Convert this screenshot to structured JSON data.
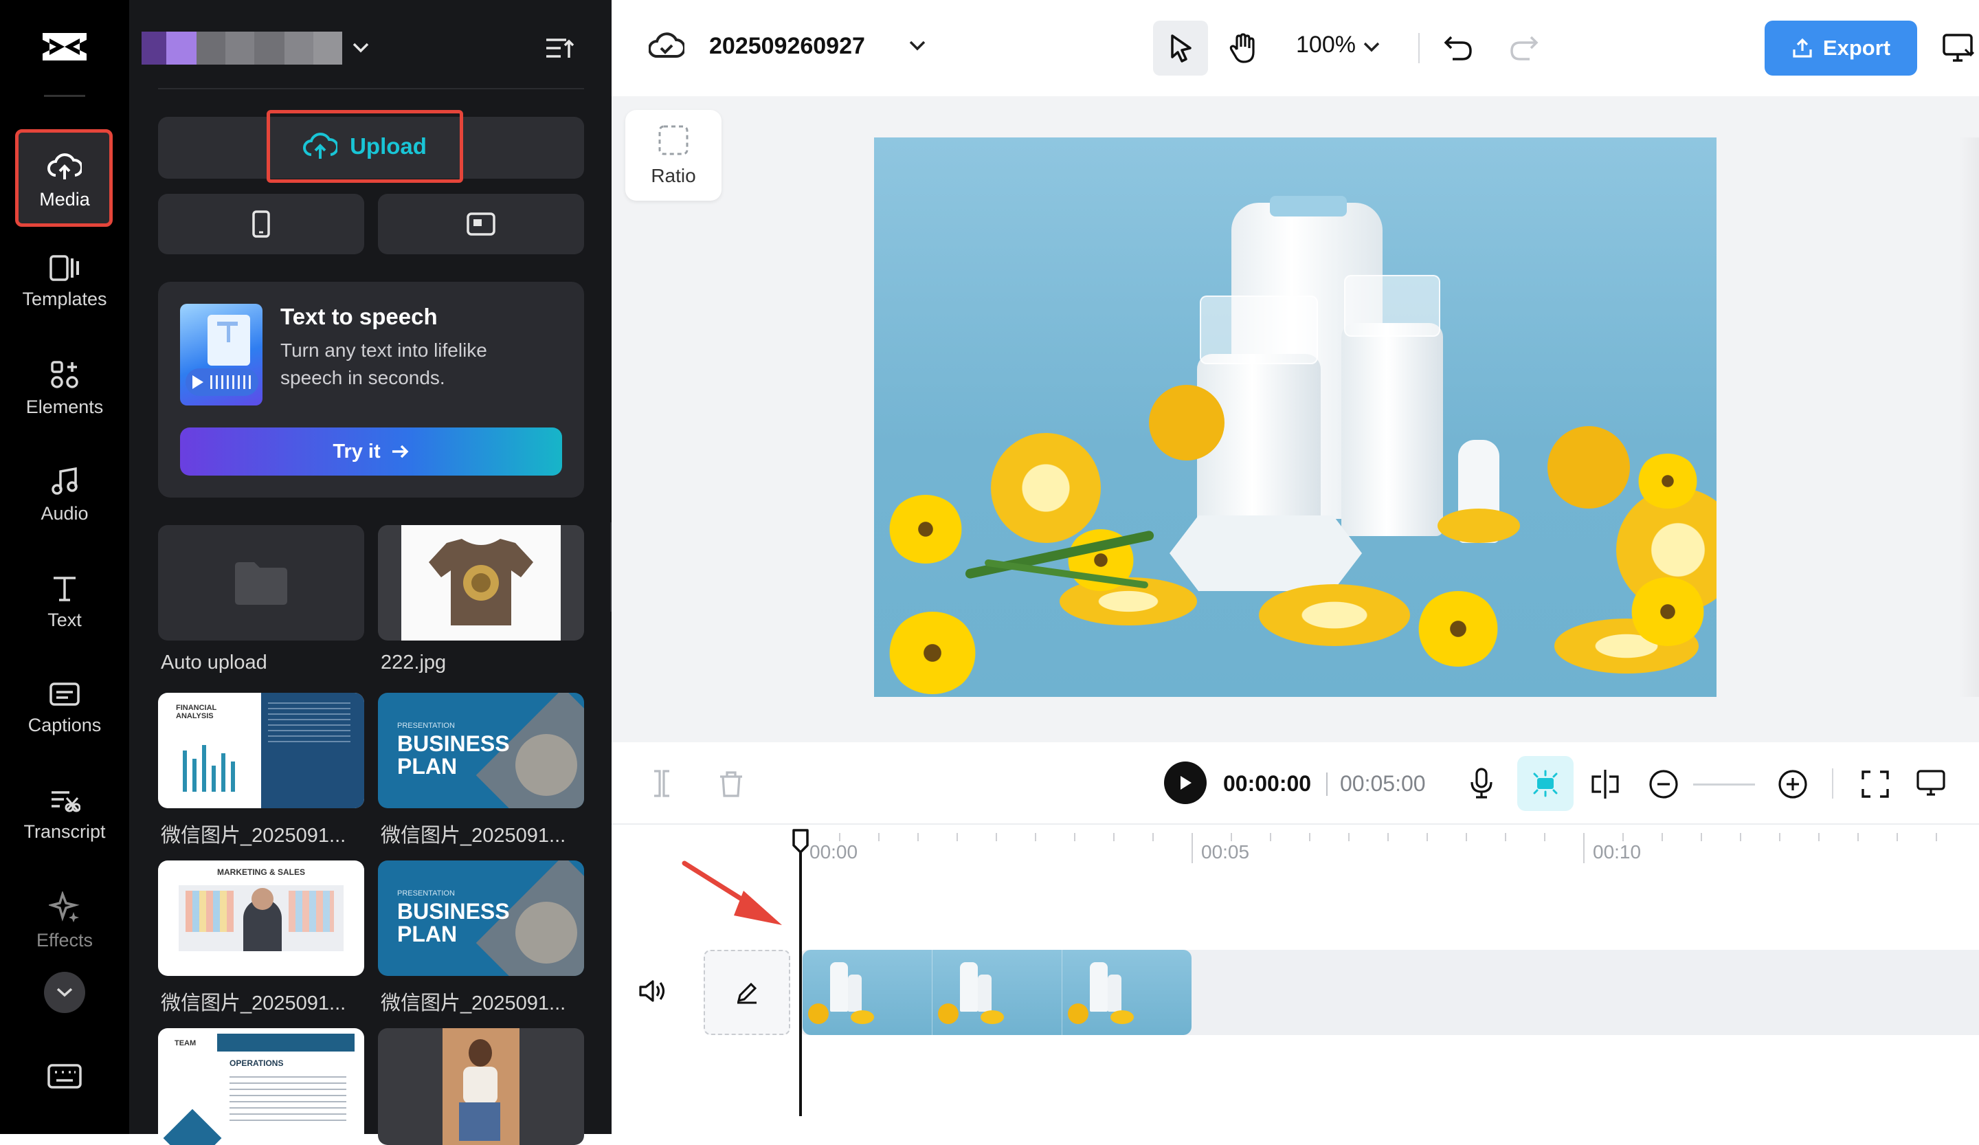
{
  "brand_colors": {
    "accent": "#2b88ff",
    "highlight_box": "#e5453a",
    "cyan": "#19c5d6",
    "rail_bg": "#000000",
    "panel_bg": "#17181b"
  },
  "rail": {
    "items": [
      {
        "label": "Media",
        "icon": "cloud-upload-icon"
      },
      {
        "label": "Templates",
        "icon": "templates-icon"
      },
      {
        "label": "Elements",
        "icon": "elements-icon"
      },
      {
        "label": "Audio",
        "icon": "music-note-icon"
      },
      {
        "label": "Text",
        "icon": "text-T-icon"
      },
      {
        "label": "Captions",
        "icon": "captions-icon"
      },
      {
        "label": "Transcript",
        "icon": "transcript-icon"
      },
      {
        "label": "Effects",
        "icon": "sparkle-icon"
      }
    ]
  },
  "panel": {
    "upload_label": "Upload",
    "tts": {
      "title": "Text to speech",
      "desc_line1": "Turn any text into lifelike",
      "desc_line2": "speech in seconds.",
      "button": "Try it"
    },
    "media": [
      {
        "caption": "Auto upload"
      },
      {
        "caption": "222.jpg"
      },
      {
        "caption": "微信图片_2025091...",
        "thumb_title": "FINANCIAL ANALYSIS"
      },
      {
        "caption": "微信图片_2025091...",
        "thumb_small": "PRESENTATION",
        "thumb_big1": "BUSINESS",
        "thumb_big2": "PLAN"
      },
      {
        "caption": "微信图片_2025091...",
        "thumb_title": "MARKETING & SALES"
      },
      {
        "caption": "微信图片_2025091...",
        "thumb_small": "PRESENTATION",
        "thumb_big1": "BUSINESS",
        "thumb_big2": "PLAN"
      },
      {
        "thumb_title": "TEAM",
        "thumb_sub": "OPERATIONS"
      },
      {}
    ]
  },
  "topbar": {
    "project_name": "202509260927",
    "zoom": "100%",
    "export_label": "Export"
  },
  "stage": {
    "ratio_label": "Ratio"
  },
  "player": {
    "current_time": "00:00:00",
    "total_time": "00:05:00"
  },
  "timeline": {
    "ruler_labels": [
      "00:00",
      "00:05",
      "00:10"
    ]
  }
}
